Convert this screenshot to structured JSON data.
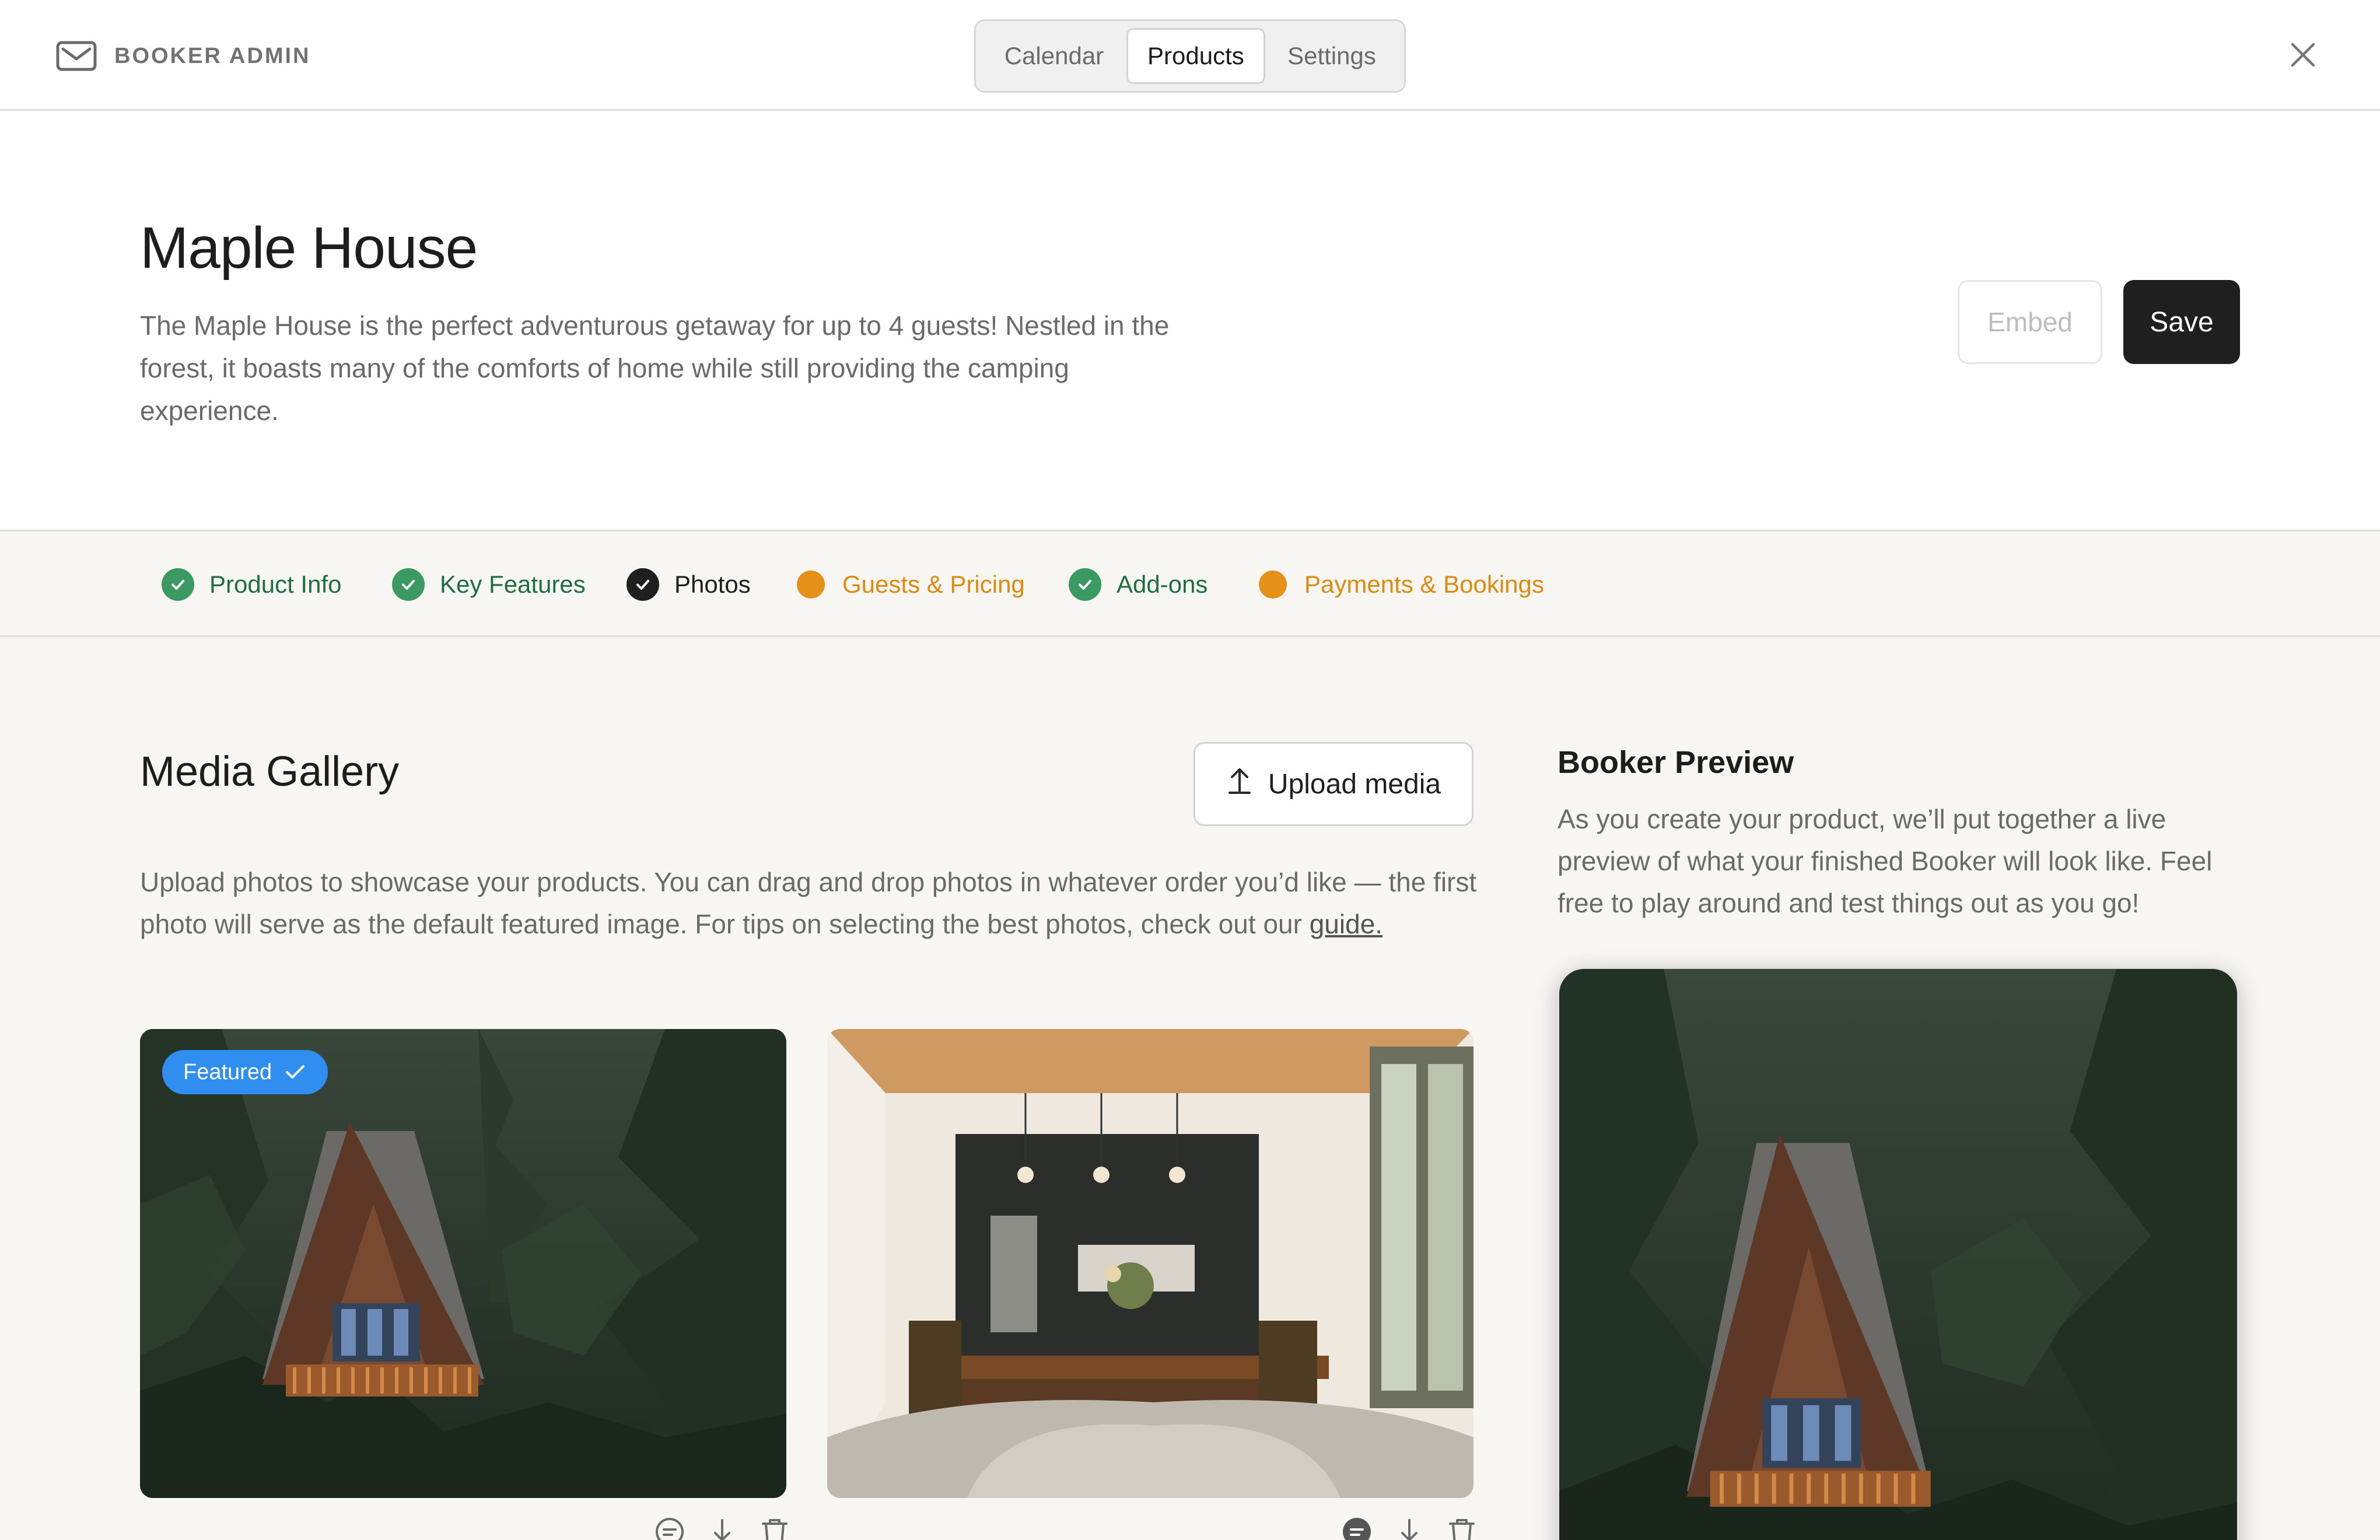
{
  "app": {
    "brand": "BOOKER ADMIN",
    "tabs": [
      "Calendar",
      "Products",
      "Settings"
    ],
    "active_tab": "Products"
  },
  "product": {
    "title": "Maple House",
    "description": "The Maple House is the perfect adventurous getaway for up to 4 guests! Nestled in the forest, it boasts many of the comforts of home while still providing the camping experience.",
    "embed_label": "Embed",
    "save_label": "Save"
  },
  "steps": [
    {
      "label": "Product Info",
      "status": "complete"
    },
    {
      "label": "Key Features",
      "status": "complete"
    },
    {
      "label": "Photos",
      "status": "current"
    },
    {
      "label": "Guests & Pricing",
      "status": "incomplete"
    },
    {
      "label": "Add-ons",
      "status": "complete"
    },
    {
      "label": "Payments & Bookings",
      "status": "incomplete"
    }
  ],
  "gallery": {
    "title": "Media Gallery",
    "upload_label": "Upload media",
    "description": "Upload photos to showcase your products. You can drag and drop photos in whatever order you’d like — the first photo will serve as the default featured image. For tips on selecting the best photos, check out our ",
    "guide_link": "guide.",
    "featured_label": "Featured"
  },
  "preview": {
    "title": "Booker Preview",
    "description": "As you create your product, we’ll put together a live preview of what your finished Booker will look like. Feel free to play around and test things out as you go!"
  },
  "colors": {
    "complete": "#3a9a62",
    "incomplete": "#e59016",
    "current": "#1f1f1f",
    "featured": "#2f8ef0",
    "save_bg": "#1f1f1f",
    "panel_bg": "#f8f6f2"
  },
  "icons": {
    "brand": "mail-icon",
    "close": "close-icon",
    "upload": "upload-icon",
    "caption": "comment-icon",
    "download": "download-icon",
    "delete": "trash-icon",
    "check": "check-icon"
  }
}
